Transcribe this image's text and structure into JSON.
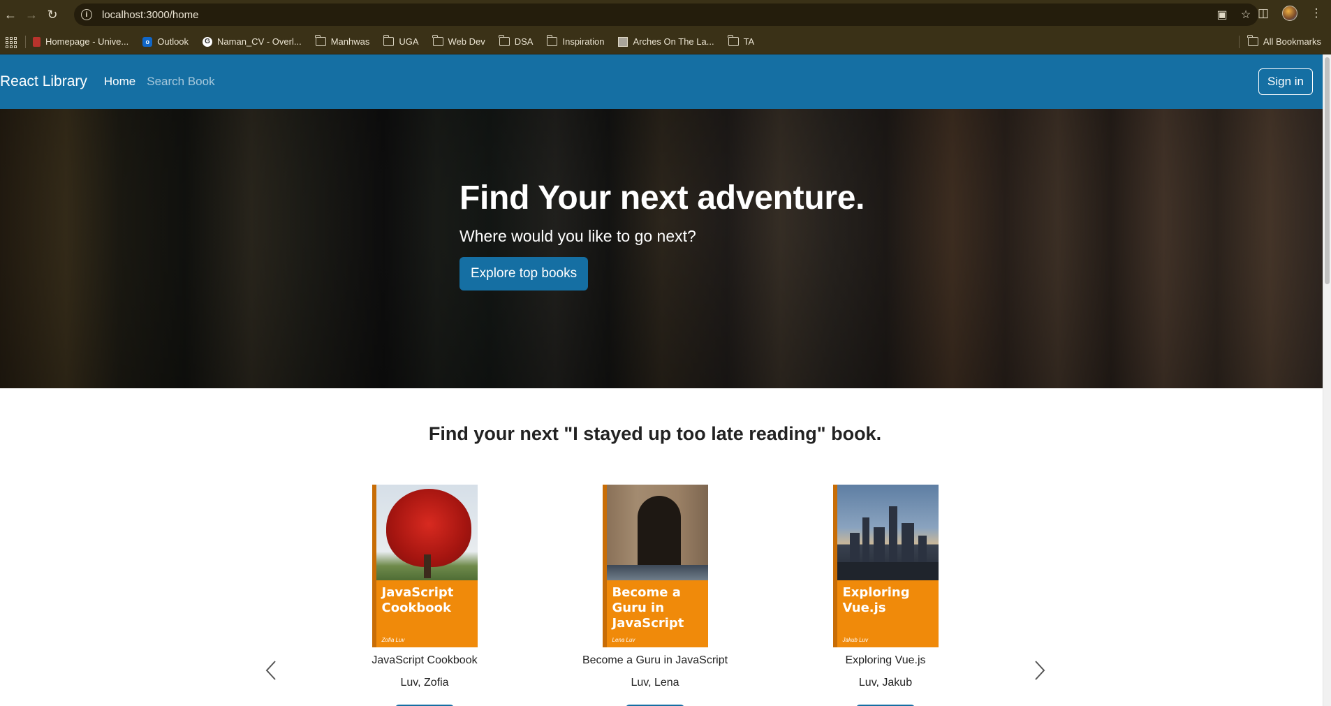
{
  "browser": {
    "url": "localhost:3000/home",
    "bookmarks": [
      {
        "label": "Homepage - Unive...",
        "icon": "red-favicon"
      },
      {
        "label": "Outlook",
        "icon": "outlook-favicon"
      },
      {
        "label": "Naman_CV - Overl...",
        "icon": "g-favicon"
      },
      {
        "label": "Manhwas",
        "icon": "folder-icon"
      },
      {
        "label": "UGA",
        "icon": "folder-icon"
      },
      {
        "label": "Web Dev",
        "icon": "folder-icon"
      },
      {
        "label": "DSA",
        "icon": "folder-icon"
      },
      {
        "label": "Inspiration",
        "icon": "folder-icon"
      },
      {
        "label": "Arches On The La...",
        "icon": "image-favicon"
      },
      {
        "label": "TA",
        "icon": "folder-icon"
      }
    ],
    "all_bookmarks": "All Bookmarks"
  },
  "navbar": {
    "brand": "React Library",
    "links": [
      "Home",
      "Search Book"
    ],
    "signin": "Sign in"
  },
  "hero": {
    "title": "Find Your next adventure.",
    "subtitle": "Where would you like to go next?",
    "button": "Explore top books"
  },
  "carousel": {
    "heading": "Find your next \"I stayed up too late reading\" book.",
    "books": [
      {
        "title": "JavaScript Cookbook",
        "author": "Luv, Zofia",
        "cover_title": "JavaScript Cookbook",
        "cover_author": "Zofia Luv"
      },
      {
        "title": "Become a Guru in JavaScript",
        "author": "Luv, Lena",
        "cover_title": "Become a Guru in JavaScript",
        "cover_author": "Lena Luv"
      },
      {
        "title": "Exploring Vue.js",
        "author": "Luv, Jakub",
        "cover_title": "Exploring Vue.js",
        "cover_author": "Jakub Luv"
      }
    ]
  },
  "colors": {
    "primary": "#156fa3",
    "cover_orange": "#f08a0a",
    "browser_chrome": "#3a3117"
  }
}
